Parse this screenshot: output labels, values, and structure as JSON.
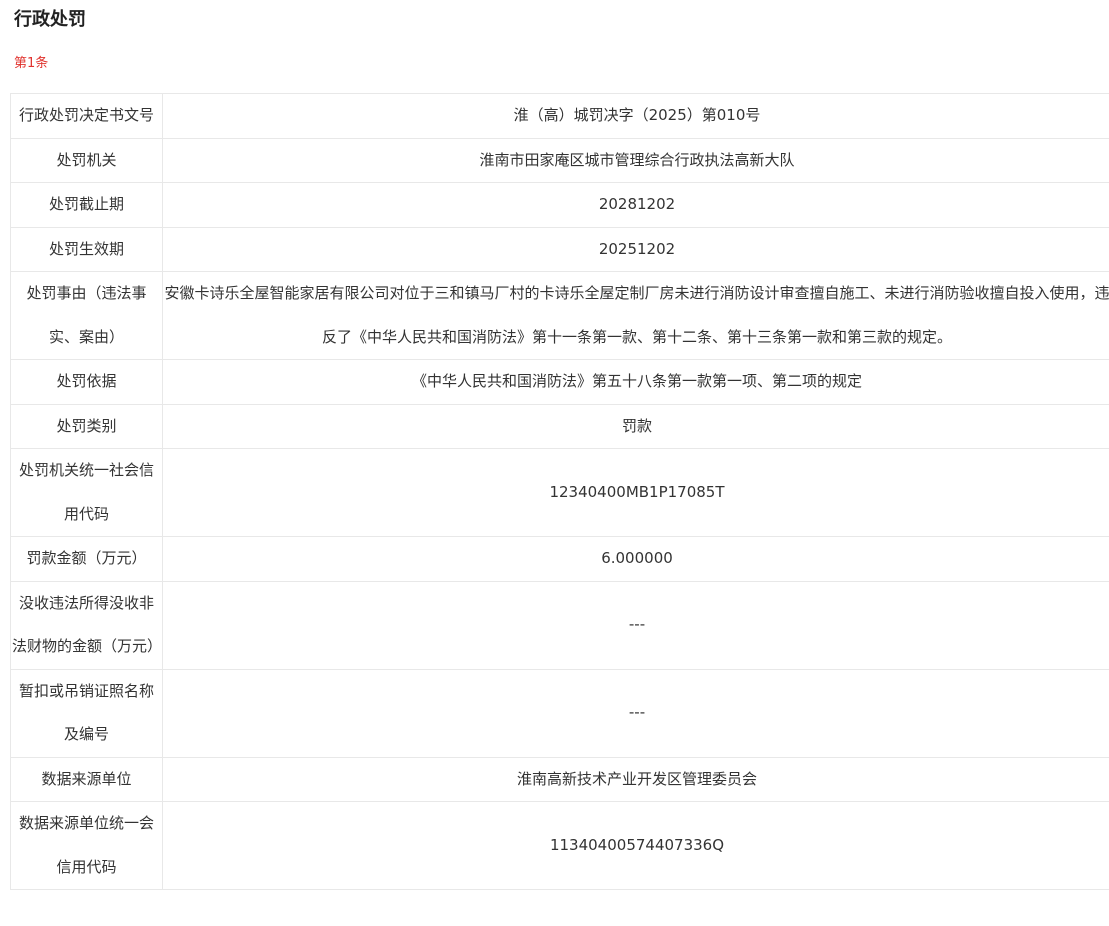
{
  "page_title": "行政处罚",
  "record_index": "第1条",
  "rows": [
    {
      "label": "行政处罚决定书文号",
      "value": "淮（高）城罚决字（2025）第010号"
    },
    {
      "label": "处罚机关",
      "value": "淮南市田家庵区城市管理综合行政执法高新大队"
    },
    {
      "label": "处罚截止期",
      "value": "20281202"
    },
    {
      "label": "处罚生效期",
      "value": "20251202"
    },
    {
      "label": "处罚事由（违法事实、案由）",
      "value": "安徽卡诗乐全屋智能家居有限公司对位于三和镇马厂村的卡诗乐全屋定制厂房未进行消防设计审查擅自施工、未进行消防验收擅自投入使用，违反了《中华人民共和国消防法》第十一条第一款、第十二条、第十三条第一款和第三款的规定。"
    },
    {
      "label": "处罚依据",
      "value": "《中华人民共和国消防法》第五十八条第一款第一项、第二项的规定"
    },
    {
      "label": "处罚类别",
      "value": "罚款"
    },
    {
      "label": "处罚机关统一社会信用代码",
      "value": "12340400MB1P17085T"
    },
    {
      "label": "罚款金额（万元）",
      "value": "6.000000"
    },
    {
      "label": "没收违法所得没收非法财物的金额（万元）",
      "value": "---"
    },
    {
      "label": "暂扣或吊销证照名称及编号",
      "value": "---"
    },
    {
      "label": "数据来源单位",
      "value": "淮南高新技术产业开发区管理委员会"
    },
    {
      "label": "数据来源单位统一会信用代码",
      "value": "11340400574407336Q"
    }
  ]
}
